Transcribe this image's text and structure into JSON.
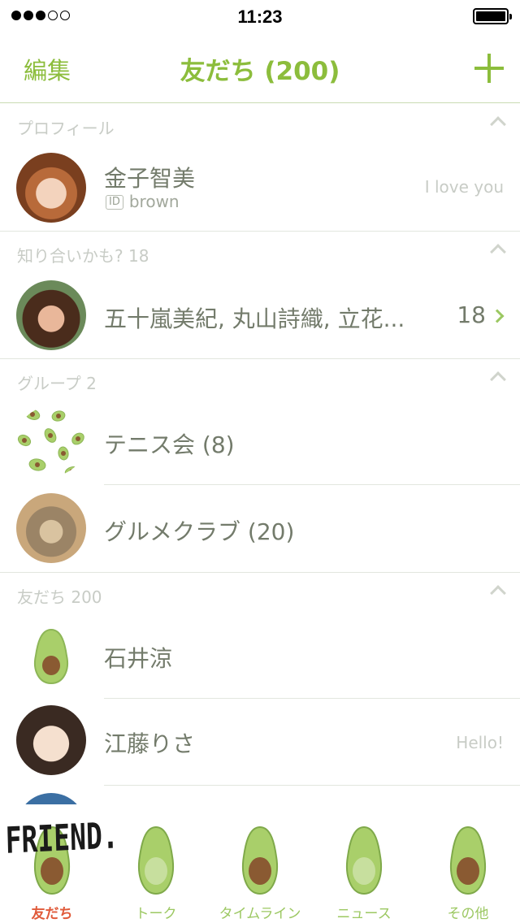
{
  "status_bar": {
    "time": "11:23",
    "signal_filled": 3,
    "signal_total": 5,
    "battery_level": 1.0
  },
  "nav": {
    "edit_label": "編集",
    "title": "友だち (200)",
    "add_icon": "plus-icon"
  },
  "profile_section": {
    "label": "プロフィール",
    "user": {
      "name": "金子智美",
      "id_badge": "ID",
      "id_value": "brown",
      "status": "I love you"
    }
  },
  "suggest_section": {
    "label": "知り合いかも? 18",
    "row": {
      "names": "五十嵐美紀, 丸山詩織, 立花...",
      "count": "18"
    }
  },
  "groups_section": {
    "label": "グループ 2",
    "items": [
      {
        "name": "テニス会 (8)"
      },
      {
        "name": "グルメクラブ (20)"
      }
    ]
  },
  "friends_section": {
    "label": "友だち 200",
    "items": [
      {
        "name": "石井涼",
        "status": ""
      },
      {
        "name": "江藤りさ",
        "status": "Hello!"
      }
    ]
  },
  "tab_bar": {
    "tabs": [
      {
        "label": "友だち",
        "active": true,
        "overlay_text": "FRIEND."
      },
      {
        "label": "トーク",
        "active": false
      },
      {
        "label": "タイムライン",
        "active": false
      },
      {
        "label": "ニュース",
        "active": false
      },
      {
        "label": "その他",
        "active": false
      }
    ]
  },
  "colors": {
    "accent": "#8cbd3c",
    "active_tab": "#e05a3a",
    "text": "#737b6b",
    "muted": "#c8ccc6"
  }
}
